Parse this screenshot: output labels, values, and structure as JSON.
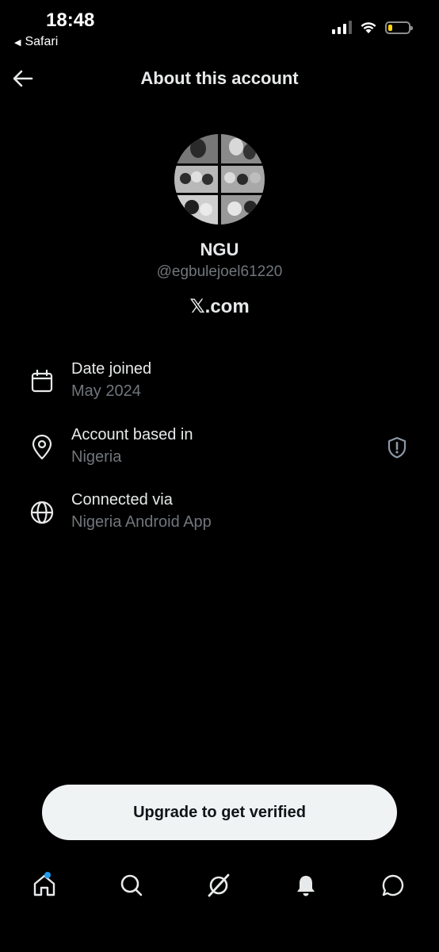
{
  "status_bar": {
    "time": "18:48",
    "back_app_label": "Safari"
  },
  "header": {
    "title": "About this account"
  },
  "profile": {
    "display_name": "NGU",
    "handle": "@egbulejoel61220",
    "site": "𝕏.com"
  },
  "info": {
    "joined_label": "Date joined",
    "joined_value": "May 2024",
    "based_label": "Account based in",
    "based_value": "Nigeria",
    "connected_label": "Connected via",
    "connected_value": "Nigeria Android App"
  },
  "cta": {
    "label": "Upgrade to get verified"
  },
  "tabs": [
    {
      "icon": "home-icon",
      "has_notification_dot": true
    },
    {
      "icon": "search-icon"
    },
    {
      "icon": "grok-icon"
    },
    {
      "icon": "bell-icon"
    },
    {
      "icon": "messages-icon"
    }
  ],
  "colors": {
    "background": "#000000",
    "primary_text": "#e7e9ea",
    "secondary_text": "#71767b",
    "accent": "#1d9bf0",
    "battery": "#ffd60a"
  }
}
